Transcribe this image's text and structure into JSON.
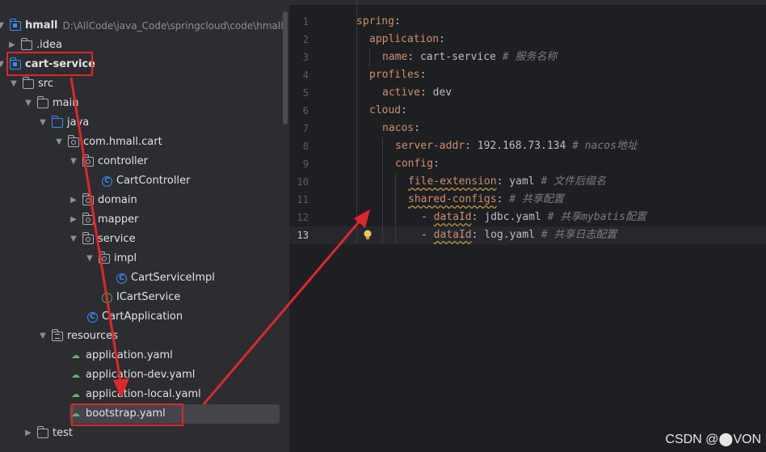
{
  "project_tree": {
    "root": {
      "label": "hmall",
      "path": "D:\\AllCode\\java_Code\\springcloud\\code\\hmall"
    },
    "nodes": [
      {
        "label": ".idea"
      },
      {
        "label": "cart-service"
      },
      {
        "label": "src"
      },
      {
        "label": "main"
      },
      {
        "label": "java"
      },
      {
        "label": "com.hmall.cart"
      },
      {
        "label": "controller"
      },
      {
        "label": "CartController",
        "icon_letter": "C"
      },
      {
        "label": "domain"
      },
      {
        "label": "mapper"
      },
      {
        "label": "service"
      },
      {
        "label": "impl"
      },
      {
        "label": "CartServiceImpl",
        "icon_letter": "C"
      },
      {
        "label": "ICartService",
        "icon_letter": "I"
      },
      {
        "label": "CartApplication",
        "icon_letter": "C"
      },
      {
        "label": "resources"
      },
      {
        "label": "application.yaml"
      },
      {
        "label": "application-dev.yaml"
      },
      {
        "label": "application-local.yaml"
      },
      {
        "label": "bootstrap.yaml"
      },
      {
        "label": "test"
      }
    ]
  },
  "editor": {
    "line_numbers": [
      "1",
      "2",
      "3",
      "4",
      "5",
      "6",
      "7",
      "8",
      "9",
      "10",
      "11",
      "12",
      "13"
    ],
    "current_line": "13",
    "lines": {
      "l1_key": "spring",
      "l2_key": "application",
      "l3_key": "name",
      "l3_val": "cart-service",
      "l3_comment": "# 服务名称",
      "l4_key": "profiles",
      "l5_key": "active",
      "l5_val": "dev",
      "l6_key": "cloud",
      "l7_key": "nacos",
      "l8_key": "server-addr",
      "l8_val": "192.168.73.134",
      "l8_comment": "# nacos地址",
      "l9_key": "config",
      "l10_key": "file-extension",
      "l10_val": "yaml",
      "l10_comment": "# 文件后缀名",
      "l11_key": "shared-configs",
      "l11_comment": "# 共享配置",
      "l12_key": "dataId",
      "l12_val": "jdbc.yaml",
      "l12_comment": "# 共享mybatis配置",
      "l13_key": "dataId",
      "l13_val": "log.yaml",
      "l13_comment": "# 共享日志配置"
    }
  },
  "watermark": "CSDN @⬤VON",
  "colors": {
    "annotation_red": "#e0262b",
    "accent_blue": "#3d8bff",
    "yaml_key": "#cf8e6d"
  }
}
